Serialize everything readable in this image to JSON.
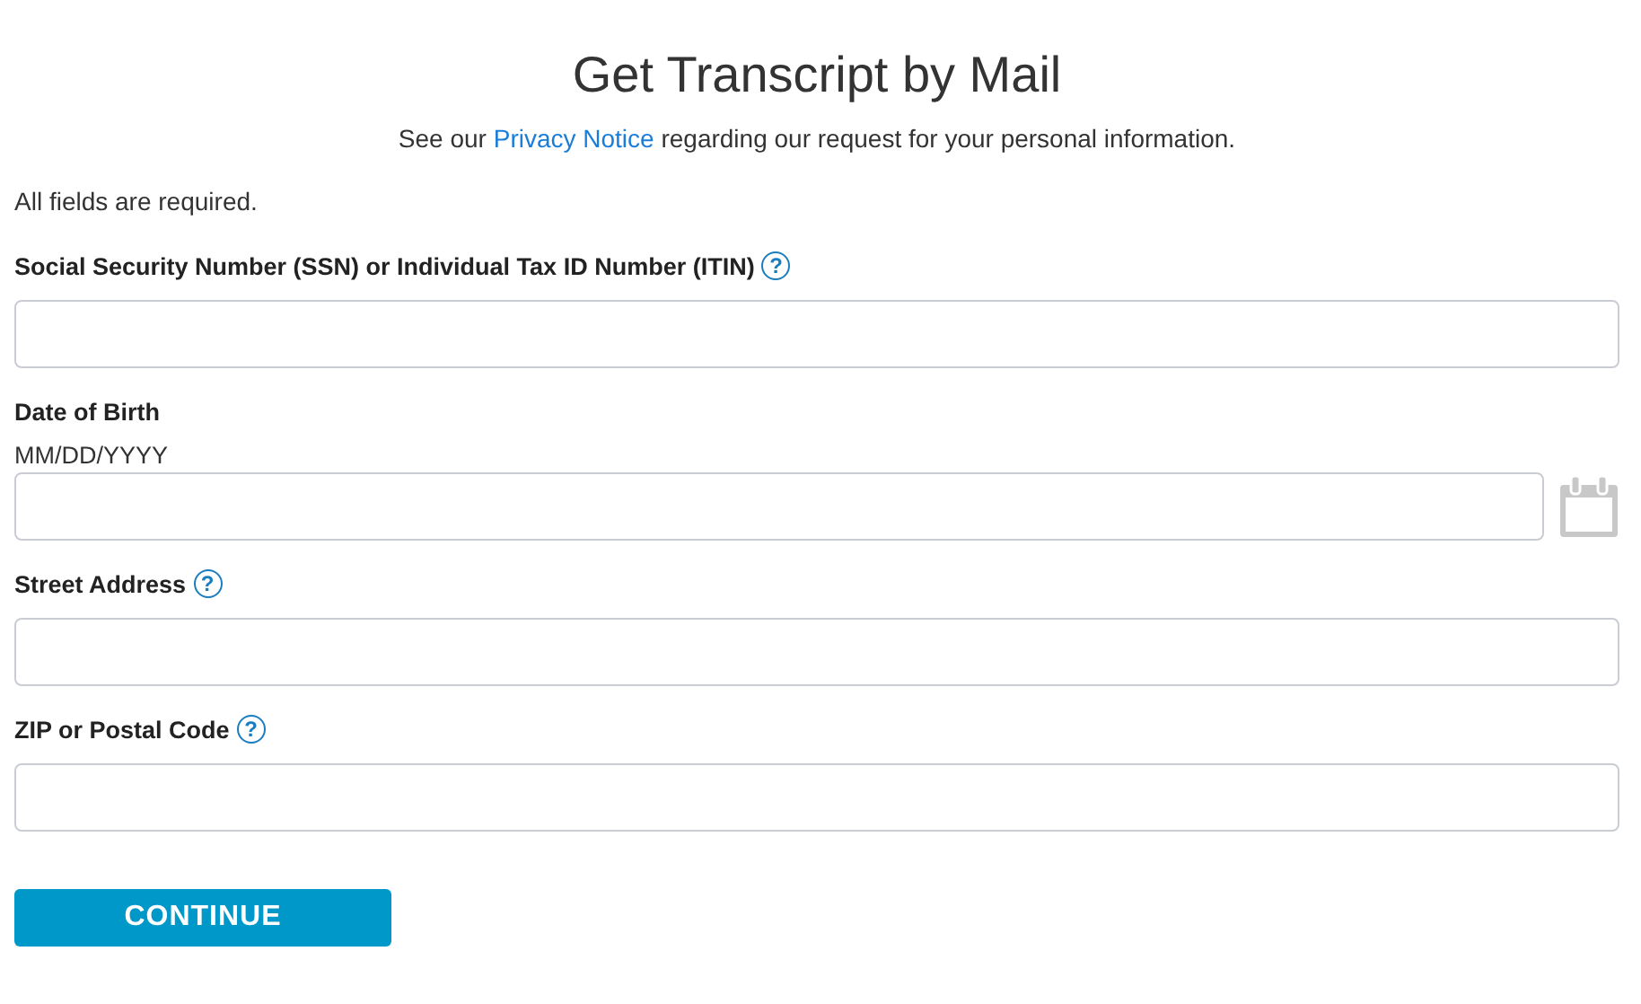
{
  "title": "Get Transcript by Mail",
  "notice": {
    "before": "See our ",
    "link": "Privacy Notice",
    "after": " regarding our request for your personal information."
  },
  "required_note": "All fields are required.",
  "fields": [
    {
      "kind": "text",
      "label": "Social Security Number (SSN) or Individual Tax ID Number (ITIN)",
      "help": "?"
    },
    {
      "kind": "date",
      "label": "Date of Birth",
      "hint": "MM/DD/YYYY"
    },
    {
      "kind": "text",
      "label": "Street Address",
      "help": "?"
    },
    {
      "kind": "text",
      "label": "ZIP or Postal Code",
      "help": "?"
    }
  ],
  "button": "CONTINUE"
}
